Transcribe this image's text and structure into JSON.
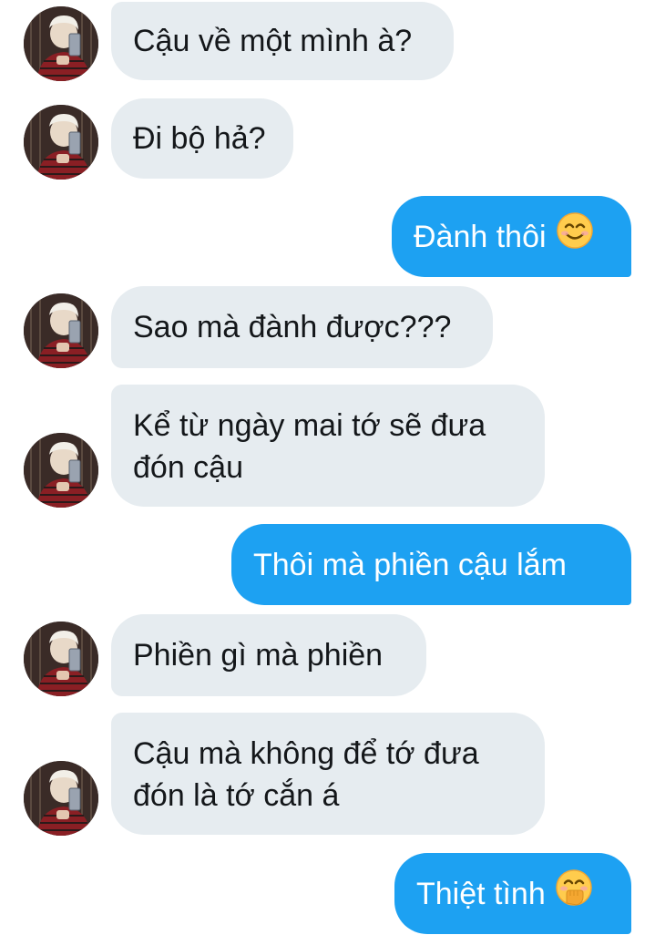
{
  "messages": [
    {
      "from": "other",
      "lines": [
        "Cậu về một mình à?"
      ]
    },
    {
      "from": "other",
      "lines": [
        "Đi bộ hả?"
      ]
    },
    {
      "from": "me",
      "lines": [
        "Đành thôi"
      ],
      "emoji": "smiling-face-emoji"
    },
    {
      "from": "other",
      "lines": [
        "Sao mà đành được???"
      ]
    },
    {
      "from": "other",
      "lines": [
        "Kể từ ngày mai tớ sẽ đưa",
        "đón cậu"
      ]
    },
    {
      "from": "me",
      "lines": [
        "Thôi mà phiền cậu lắm"
      ]
    },
    {
      "from": "other",
      "lines": [
        "Phiền gì mà phiền"
      ]
    },
    {
      "from": "other",
      "lines": [
        "Cậu mà không để tớ đưa",
        "đón là tớ cắn á"
      ]
    },
    {
      "from": "me",
      "lines": [
        "Thiệt tình"
      ],
      "emoji": "face-with-hand-over-mouth-emoji"
    }
  ],
  "colors": {
    "incoming_bubble": "#e6ecf0",
    "outgoing_bubble": "#1da1f2",
    "incoming_text": "#14171a",
    "outgoing_text": "#ffffff"
  }
}
